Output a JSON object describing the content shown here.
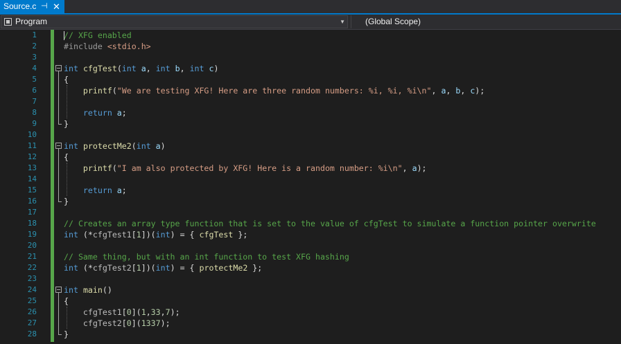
{
  "tab": {
    "title": "Source.c",
    "pin_icon": "pin-icon",
    "close_icon": "close-icon"
  },
  "navbar": {
    "project": "Program",
    "project_icon": "project-icon",
    "scope": "(Global Scope)"
  },
  "colors": {
    "accent": "#007acc",
    "keyword": "#569cd6",
    "comment": "#57a64a",
    "string": "#d69d85",
    "line_number": "#2b91af"
  },
  "lines": [
    {
      "n": "1",
      "tokens": [
        [
          "cm",
          "// XFG enabled"
        ]
      ]
    },
    {
      "n": "2",
      "tokens": [
        [
          "pp",
          "#include "
        ],
        [
          "st",
          "<stdio.h>"
        ]
      ]
    },
    {
      "n": "3",
      "tokens": []
    },
    {
      "n": "4",
      "tokens": [
        [
          "kw",
          "int"
        ],
        [
          "",
          " "
        ],
        [
          "fn",
          "cfgTest"
        ],
        [
          "",
          "("
        ],
        [
          "kw",
          "int"
        ],
        [
          "",
          " "
        ],
        [
          "va",
          "a"
        ],
        [
          "",
          ", "
        ],
        [
          "kw",
          "int"
        ],
        [
          "",
          " "
        ],
        [
          "va",
          "b"
        ],
        [
          "",
          ", "
        ],
        [
          "kw",
          "int"
        ],
        [
          "",
          " "
        ],
        [
          "va",
          "c"
        ],
        [
          "",
          ")"
        ]
      ]
    },
    {
      "n": "5",
      "tokens": [
        [
          "",
          "{"
        ]
      ]
    },
    {
      "n": "6",
      "tokens": [
        [
          "",
          "    "
        ],
        [
          "fn",
          "printf"
        ],
        [
          "",
          "("
        ],
        [
          "st",
          "\"We are testing XFG! Here are three random numbers: %i, %i, %i\\n\""
        ],
        [
          "",
          ", "
        ],
        [
          "va",
          "a"
        ],
        [
          "",
          ", "
        ],
        [
          "va",
          "b"
        ],
        [
          "",
          ", "
        ],
        [
          "va",
          "c"
        ],
        [
          "",
          ");"
        ]
      ]
    },
    {
      "n": "7",
      "tokens": []
    },
    {
      "n": "8",
      "tokens": [
        [
          "",
          "    "
        ],
        [
          "kw",
          "return"
        ],
        [
          "",
          " "
        ],
        [
          "va",
          "a"
        ],
        [
          "",
          ";"
        ]
      ]
    },
    {
      "n": "9",
      "tokens": [
        [
          "",
          "}"
        ]
      ]
    },
    {
      "n": "10",
      "tokens": []
    },
    {
      "n": "11",
      "tokens": [
        [
          "kw",
          "int"
        ],
        [
          "",
          " "
        ],
        [
          "fn",
          "protectMe2"
        ],
        [
          "",
          "("
        ],
        [
          "kw",
          "int"
        ],
        [
          "",
          " "
        ],
        [
          "va",
          "a"
        ],
        [
          "",
          ")"
        ]
      ]
    },
    {
      "n": "12",
      "tokens": [
        [
          "",
          "{"
        ]
      ]
    },
    {
      "n": "13",
      "tokens": [
        [
          "",
          "    "
        ],
        [
          "fn",
          "printf"
        ],
        [
          "",
          "("
        ],
        [
          "st",
          "\"I am also protected by XFG! Here is a random number: %i\\n\""
        ],
        [
          "",
          ", "
        ],
        [
          "va",
          "a"
        ],
        [
          "",
          ");"
        ]
      ]
    },
    {
      "n": "14",
      "tokens": []
    },
    {
      "n": "15",
      "tokens": [
        [
          "",
          "    "
        ],
        [
          "kw",
          "return"
        ],
        [
          "",
          " "
        ],
        [
          "va",
          "a"
        ],
        [
          "",
          ";"
        ]
      ]
    },
    {
      "n": "16",
      "tokens": [
        [
          "",
          "}"
        ]
      ]
    },
    {
      "n": "17",
      "tokens": []
    },
    {
      "n": "18",
      "tokens": [
        [
          "cm",
          "// Creates an array type function that is set to the value of cfgTest to simulate a function pointer overwrite"
        ]
      ]
    },
    {
      "n": "19",
      "tokens": [
        [
          "kw",
          "int"
        ],
        [
          "",
          " (*"
        ],
        [
          "gv",
          "cfgTest1"
        ],
        [
          "",
          "["
        ],
        [
          "nu",
          "1"
        ],
        [
          "",
          "])("
        ],
        [
          "kw",
          "int"
        ],
        [
          "",
          ") = { "
        ],
        [
          "fn",
          "cfgTest"
        ],
        [
          "",
          " };"
        ]
      ]
    },
    {
      "n": "20",
      "tokens": []
    },
    {
      "n": "21",
      "tokens": [
        [
          "cm",
          "// Same thing, but with an int function to test XFG hashing"
        ]
      ]
    },
    {
      "n": "22",
      "tokens": [
        [
          "kw",
          "int"
        ],
        [
          "",
          " (*"
        ],
        [
          "gv",
          "cfgTest2"
        ],
        [
          "",
          "["
        ],
        [
          "nu",
          "1"
        ],
        [
          "",
          "])("
        ],
        [
          "kw",
          "int"
        ],
        [
          "",
          ") = { "
        ],
        [
          "fn",
          "protectMe2"
        ],
        [
          "",
          " };"
        ]
      ]
    },
    {
      "n": "23",
      "tokens": []
    },
    {
      "n": "24",
      "tokens": [
        [
          "kw",
          "int"
        ],
        [
          "",
          " "
        ],
        [
          "fn",
          "main"
        ],
        [
          "",
          "()"
        ]
      ]
    },
    {
      "n": "25",
      "tokens": [
        [
          "",
          "{"
        ]
      ]
    },
    {
      "n": "26",
      "tokens": [
        [
          "",
          "    "
        ],
        [
          "gv",
          "cfgTest1"
        ],
        [
          "",
          "["
        ],
        [
          "nu",
          "0"
        ],
        [
          "",
          "]("
        ],
        [
          "nu",
          "1"
        ],
        [
          "",
          ","
        ],
        [
          "nu",
          "33"
        ],
        [
          "",
          ","
        ],
        [
          "nu",
          "7"
        ],
        [
          "",
          ");"
        ]
      ]
    },
    {
      "n": "27",
      "tokens": [
        [
          "",
          "    "
        ],
        [
          "gv",
          "cfgTest2"
        ],
        [
          "",
          "["
        ],
        [
          "nu",
          "0"
        ],
        [
          "",
          "]("
        ],
        [
          "nu",
          "1337"
        ],
        [
          "",
          ");"
        ]
      ]
    },
    {
      "n": "28",
      "tokens": [
        [
          "",
          "}"
        ]
      ]
    }
  ]
}
